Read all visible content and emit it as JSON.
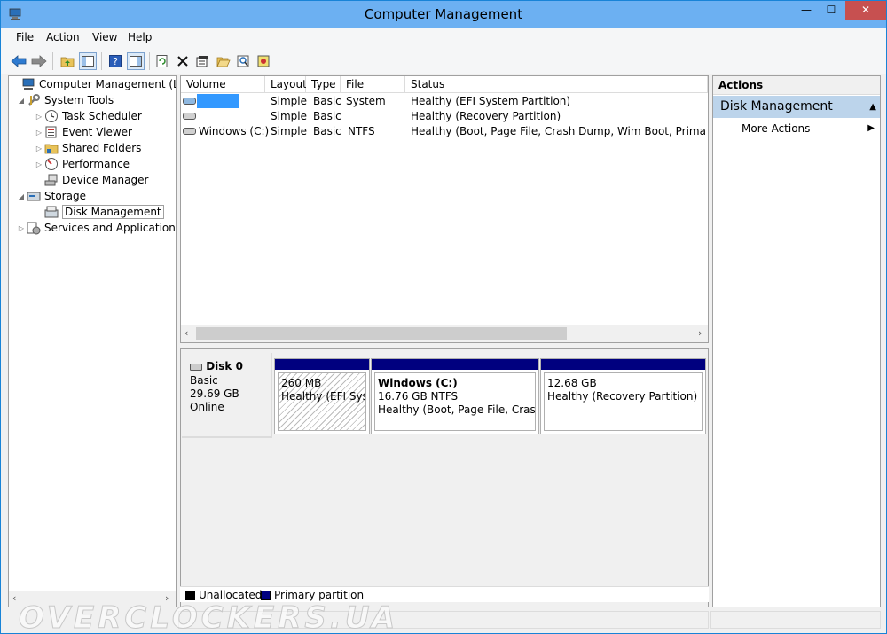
{
  "window": {
    "title": "Computer Management",
    "min_label": "—",
    "max_label": "☐",
    "close_label": "✕"
  },
  "menu": [
    "File",
    "Action",
    "View",
    "Help"
  ],
  "tree": {
    "root": "Computer Management (Local",
    "system_tools": "System Tools",
    "task_scheduler": "Task Scheduler",
    "event_viewer": "Event Viewer",
    "shared_folders": "Shared Folders",
    "performance": "Performance",
    "device_manager": "Device Manager",
    "storage": "Storage",
    "disk_management": "Disk Management",
    "services": "Services and Applications"
  },
  "volumes": {
    "columns": [
      "Volume",
      "Layout",
      "Type",
      "File System",
      "Status"
    ],
    "rows": [
      {
        "volume": "",
        "layout": "Simple",
        "type": "Basic",
        "fs": "",
        "status": "Healthy (EFI System Partition)"
      },
      {
        "volume": "",
        "layout": "Simple",
        "type": "Basic",
        "fs": "",
        "status": "Healthy (Recovery Partition)"
      },
      {
        "volume": "Windows (C:)",
        "layout": "Simple",
        "type": "Basic",
        "fs": "NTFS",
        "status": "Healthy (Boot, Page File, Crash Dump, Wim Boot, Primary Partit"
      }
    ]
  },
  "disk": {
    "name": "Disk 0",
    "type": "Basic",
    "size": "29.69 GB",
    "status": "Online",
    "partitions": [
      {
        "title": "",
        "size": "260 MB",
        "status": "Healthy (EFI Syste"
      },
      {
        "title": "Windows  (C:)",
        "size": "16.76 GB NTFS",
        "status": "Healthy (Boot, Page File, Crash Du"
      },
      {
        "title": "",
        "size": "12.68 GB",
        "status": "Healthy (Recovery Partition)"
      }
    ]
  },
  "legend": {
    "unallocated": "Unallocated",
    "primary": "Primary partition"
  },
  "actions": {
    "header": "Actions",
    "section": "Disk Management",
    "more": "More Actions"
  },
  "watermark": "OVERCLOCKERS.UA",
  "colors": {
    "partition_bar": "#00007f",
    "selection": "#bcd4eb",
    "close_button": "#c75050",
    "titlebar": "#6cb0f2"
  },
  "icons": [
    "back-icon",
    "forward-icon",
    "up-folder-icon",
    "show-hide-tree-icon",
    "help-icon",
    "console-tree-icon",
    "refresh-icon",
    "delete-icon",
    "properties-icon",
    "open-icon",
    "search-icon",
    "export-icon"
  ]
}
